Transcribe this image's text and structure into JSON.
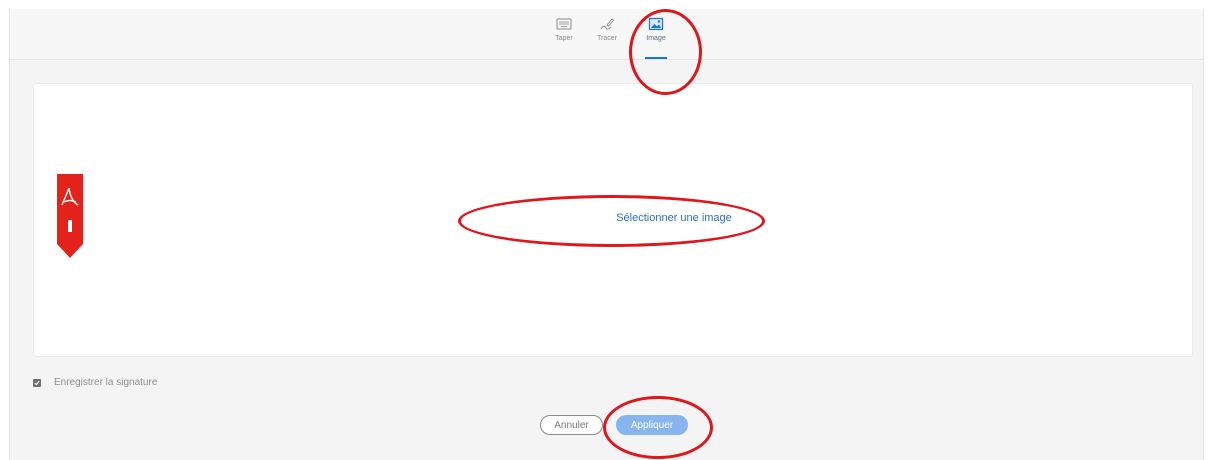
{
  "tabs": [
    {
      "label": "Taper",
      "icon": "keyboard-icon",
      "active": false
    },
    {
      "label": "Tracer",
      "icon": "pen-draw-icon",
      "active": false
    },
    {
      "label": "Image",
      "icon": "image-icon",
      "active": true
    }
  ],
  "canvas": {
    "select_image_label": "Sélectionner une image",
    "logo": "adobe-pdf-ribbon"
  },
  "save_signature": {
    "label": "Enregistrer la signature",
    "checked": true
  },
  "buttons": {
    "cancel_label": "Annuler",
    "apply_label": "Appliquer"
  },
  "colors": {
    "accent": "#1473e6",
    "apply_button": "#86b5ef",
    "link": "#2d6ec9",
    "annotation": "#e0161c",
    "pdf_red": "#e3231b"
  }
}
